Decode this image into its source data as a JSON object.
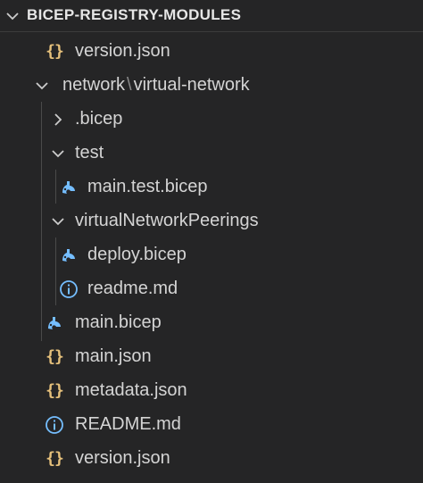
{
  "header": {
    "title": "BICEP-REGISTRY-MODULES",
    "collapse_icon": "chevron-down-icon"
  },
  "tree": [
    {
      "label": "version.json",
      "type": "file",
      "icon": "json-icon",
      "depth": 1
    },
    {
      "label_parts": [
        "network",
        "\\",
        "virtual-network"
      ],
      "type": "folder",
      "expanded": true,
      "icon": "chevron-down-icon",
      "depth": 0
    },
    {
      "label": ".bicep",
      "type": "folder",
      "expanded": false,
      "icon": "chevron-right-icon",
      "depth": 1
    },
    {
      "label": "test",
      "type": "folder",
      "expanded": true,
      "icon": "chevron-down-icon",
      "depth": 1
    },
    {
      "label": "main.test.bicep",
      "type": "file",
      "icon": "bicep-icon",
      "depth": 2
    },
    {
      "label": "virtualNetworkPeerings",
      "type": "folder",
      "expanded": true,
      "icon": "chevron-down-icon",
      "depth": 1
    },
    {
      "label": "deploy.bicep",
      "type": "file",
      "icon": "bicep-icon",
      "depth": 2
    },
    {
      "label": "readme.md",
      "type": "file",
      "icon": "info-icon",
      "depth": 2
    },
    {
      "label": "main.bicep",
      "type": "file",
      "icon": "bicep-icon",
      "depth": 1
    },
    {
      "label": "main.json",
      "type": "file",
      "icon": "json-icon",
      "depth": 1
    },
    {
      "label": "metadata.json",
      "type": "file",
      "icon": "json-icon",
      "depth": 1
    },
    {
      "label": "README.md",
      "type": "file",
      "icon": "info-icon",
      "depth": 1
    },
    {
      "label": "version.json",
      "type": "file",
      "icon": "json-icon",
      "depth": 1
    }
  ],
  "colors": {
    "background": "#252526",
    "text": "#d4d4d4",
    "json_icon": "#e5c07b",
    "bicep_icon": "#75beff",
    "info_icon": "#75beff"
  }
}
